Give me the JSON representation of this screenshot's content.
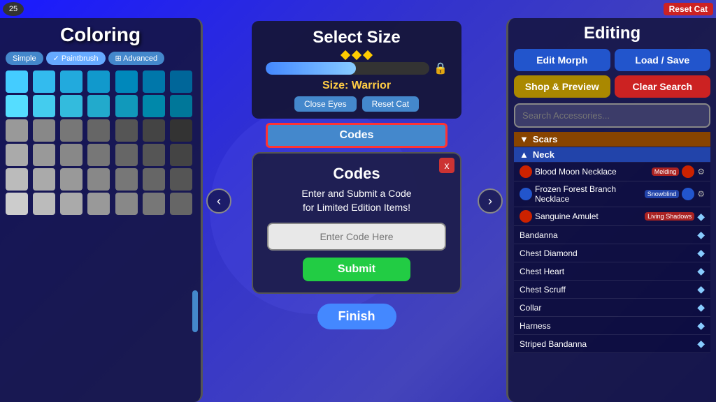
{
  "topbar": {
    "level": "25",
    "reset_btn": "Reset Cat"
  },
  "left_panel": {
    "title": "Coloring",
    "tabs": [
      "Simple",
      "✓ Paintbrush",
      "⊞ Advanced"
    ]
  },
  "center_panel": {
    "select_size_title": "Select Size",
    "size_label": "Size: Warrior",
    "close_eyes_btn": "Close Eyes",
    "reset_cat_btn": "Reset Cat",
    "codes_btn": "Codes",
    "modal": {
      "title": "Codes",
      "subtitle": "Enter and Submit a Code\nfor Limited Edition Items!",
      "input_placeholder": "Enter Code Here",
      "submit_btn": "Submit",
      "close_btn": "x"
    },
    "finish_btn": "Finish"
  },
  "right_panel": {
    "title": "Editing",
    "buttons": {
      "edit_morph": "Edit Morph",
      "load_save": "Load / Save",
      "shop_preview": "Shop & Preview",
      "clear_search": "Clear Search"
    },
    "search_placeholder": "Search Accessories...",
    "sections": [
      {
        "name": "Scars",
        "state": "collapsed",
        "arrow": "▼"
      },
      {
        "name": "Neck",
        "state": "expanded",
        "arrow": "▲"
      }
    ],
    "accessories": [
      {
        "name": "Blood Moon Necklace",
        "badge": "Melding",
        "badge_type": "red",
        "has_icon": true,
        "icon_color": "red",
        "has_diamond": false
      },
      {
        "name": "Frozen Forest Branch\nNecklace",
        "badge": "Snowblind",
        "badge_type": "blue",
        "has_icon": true,
        "icon_color": "blue",
        "has_diamond": false
      },
      {
        "name": "Sanguine Amulet",
        "badge": "Living\nShadows",
        "badge_type": "red",
        "has_icon": true,
        "icon_color": "red",
        "has_diamond": true
      },
      {
        "name": "Bandanna",
        "badge": "",
        "badge_type": "",
        "has_icon": false,
        "has_diamond": true
      },
      {
        "name": "Chest Diamond",
        "badge": "",
        "badge_type": "",
        "has_icon": false,
        "has_diamond": true
      },
      {
        "name": "Chest Heart",
        "badge": "",
        "badge_type": "",
        "has_icon": false,
        "has_diamond": true
      },
      {
        "name": "Chest Scruff",
        "badge": "",
        "badge_type": "",
        "has_icon": false,
        "has_diamond": true
      },
      {
        "name": "Collar",
        "badge": "",
        "badge_type": "",
        "has_icon": false,
        "has_diamond": true
      },
      {
        "name": "Harness",
        "badge": "",
        "badge_type": "",
        "has_icon": false,
        "has_diamond": true
      },
      {
        "name": "Striped Bandanna",
        "badge": "",
        "badge_type": "",
        "has_icon": false,
        "has_diamond": true
      }
    ]
  },
  "nav": {
    "left_arrow": "‹",
    "right_arrow": "›"
  }
}
